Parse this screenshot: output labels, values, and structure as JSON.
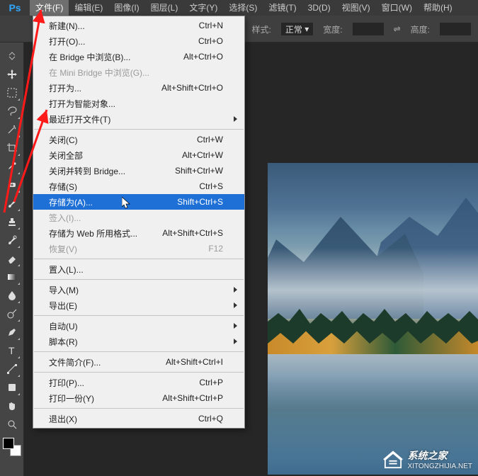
{
  "menubar": {
    "items": [
      {
        "label": "文件(F)",
        "active": true
      },
      {
        "label": "编辑(E)"
      },
      {
        "label": "图像(I)"
      },
      {
        "label": "图层(L)"
      },
      {
        "label": "文字(Y)"
      },
      {
        "label": "选择(S)"
      },
      {
        "label": "滤镜(T)"
      },
      {
        "label": "3D(D)"
      },
      {
        "label": "视图(V)"
      },
      {
        "label": "窗口(W)"
      },
      {
        "label": "帮助(H)"
      }
    ]
  },
  "optionsbar": {
    "style_label": "样式:",
    "style_value": "正常",
    "width_label": "宽度:",
    "height_label": "高度:",
    "swap_icon": "⇌"
  },
  "dropdown": {
    "items": [
      {
        "label": "新建(N)...",
        "shortcut": "Ctrl+N"
      },
      {
        "label": "打开(O)...",
        "shortcut": "Ctrl+O"
      },
      {
        "label": "在 Bridge 中浏览(B)...",
        "shortcut": "Alt+Ctrl+O"
      },
      {
        "label": "在 Mini Bridge 中浏览(G)...",
        "disabled": true
      },
      {
        "label": "打开为...",
        "shortcut": "Alt+Shift+Ctrl+O"
      },
      {
        "label": "打开为智能对象..."
      },
      {
        "label": "最近打开文件(T)",
        "submenu": true
      },
      {
        "separator": true
      },
      {
        "label": "关闭(C)",
        "shortcut": "Ctrl+W"
      },
      {
        "label": "关闭全部",
        "shortcut": "Alt+Ctrl+W"
      },
      {
        "label": "关闭并转到 Bridge...",
        "shortcut": "Shift+Ctrl+W"
      },
      {
        "label": "存储(S)",
        "shortcut": "Ctrl+S"
      },
      {
        "label": "存储为(A)...",
        "shortcut": "Shift+Ctrl+S",
        "highlight": true
      },
      {
        "label": "签入(I)...",
        "disabled": true
      },
      {
        "label": "存储为 Web 所用格式...",
        "shortcut": "Alt+Shift+Ctrl+S"
      },
      {
        "label": "恢复(V)",
        "shortcut": "F12",
        "disabled": true
      },
      {
        "separator": true
      },
      {
        "label": "置入(L)..."
      },
      {
        "separator": true
      },
      {
        "label": "导入(M)",
        "submenu": true
      },
      {
        "label": "导出(E)",
        "submenu": true
      },
      {
        "separator": true
      },
      {
        "label": "自动(U)",
        "submenu": true
      },
      {
        "label": "脚本(R)",
        "submenu": true
      },
      {
        "separator": true
      },
      {
        "label": "文件简介(F)...",
        "shortcut": "Alt+Shift+Ctrl+I"
      },
      {
        "separator": true
      },
      {
        "label": "打印(P)...",
        "shortcut": "Ctrl+P"
      },
      {
        "label": "打印一份(Y)",
        "shortcut": "Alt+Shift+Ctrl+P"
      },
      {
        "separator": true
      },
      {
        "label": "退出(X)",
        "shortcut": "Ctrl+Q"
      }
    ]
  },
  "tools": [
    "move",
    "marquee",
    "lasso",
    "wand",
    "crop",
    "eyedropper",
    "heal",
    "brush",
    "stamp",
    "history",
    "eraser",
    "gradient",
    "blur",
    "dodge",
    "pen",
    "type",
    "path",
    "shape",
    "hand",
    "zoom"
  ],
  "watermark": {
    "title": "系统之家",
    "url": "XITONGZHIJIA.NET"
  }
}
